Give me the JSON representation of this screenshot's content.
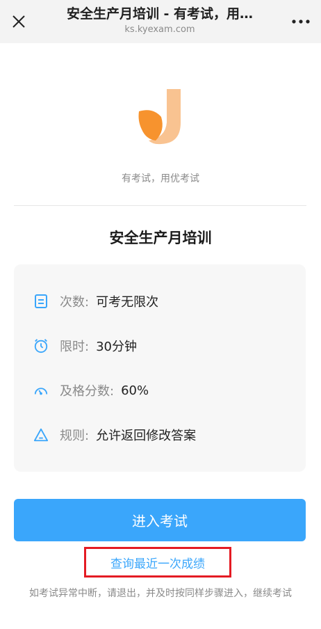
{
  "header": {
    "title": "安全生产月培训 - 有考试，用…",
    "url": "ks.kyexam.com"
  },
  "brand": {
    "slogan": "有考试，用优考试",
    "colors": {
      "orange": "#F7932E",
      "light_orange": "#F9C391"
    }
  },
  "exam": {
    "title": "安全生产月培训",
    "info": [
      {
        "icon": "document-icon",
        "label": "次数:",
        "value": "可考无限次"
      },
      {
        "icon": "clock-icon",
        "label": "限时:",
        "value": "30分钟"
      },
      {
        "icon": "gauge-icon",
        "label": "及格分数:",
        "value": "60%"
      },
      {
        "icon": "warning-triangle-icon",
        "label": "规则:",
        "value": "允许返回修改答案"
      }
    ]
  },
  "actions": {
    "enter_label": "进入考试",
    "query_label": "查询最近一次成绩"
  },
  "notice": "如考试异常中断，请退出，并及时按同样步骤进入，继续考试",
  "accent_color": "#3AA6FB",
  "highlight_color": "#E41B23"
}
